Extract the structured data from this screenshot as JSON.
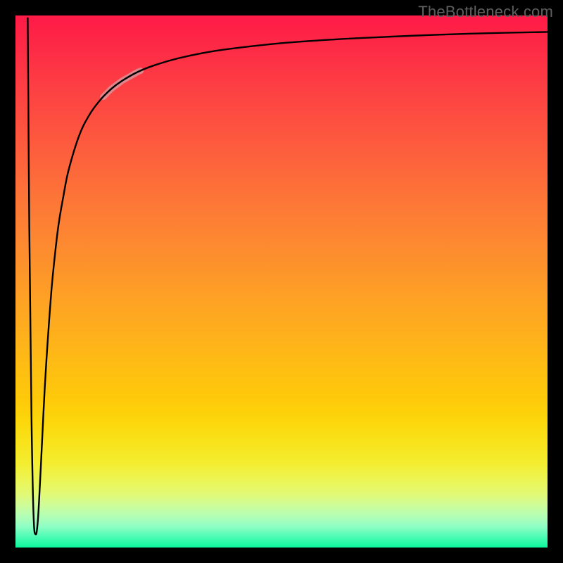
{
  "watermark": "TheBottleneck.com",
  "colors": {
    "page_bg": "#000000",
    "curve_stroke": "#000000",
    "highlight_stroke": "#d79aa0",
    "gradient_top": "#fe1a47",
    "gradient_mid": "#fec90a",
    "gradient_bottom": "#0cf69c",
    "watermark_color": "#5e5e5e"
  },
  "chart_data": {
    "type": "line",
    "title": "",
    "xlabel": "",
    "ylabel": "",
    "xlim": [
      0,
      100
    ],
    "ylim": [
      0,
      100
    ],
    "grid": false,
    "legend": false,
    "series": [
      {
        "name": "bottleneck-curve",
        "x": [
          2.3,
          2.6,
          3.0,
          3.4,
          3.8,
          4.2,
          4.6,
          5.0,
          5.5,
          6.0,
          6.5,
          7.0,
          8.0,
          9.0,
          10,
          12,
          14,
          16,
          18,
          20,
          23,
          26,
          30,
          35,
          40,
          50,
          60,
          70,
          80,
          90,
          100
        ],
        "y": [
          99.5,
          60,
          25,
          6,
          2.5,
          5,
          12,
          20,
          30,
          38,
          45,
          51,
          60,
          66,
          71,
          77.5,
          81.5,
          84.2,
          86.2,
          87.7,
          89.4,
          90.6,
          91.8,
          92.9,
          93.7,
          94.8,
          95.5,
          96.0,
          96.4,
          96.7,
          96.9
        ]
      }
    ],
    "annotations": [
      {
        "name": "highlight-segment",
        "x_range": [
          16.5,
          23.5
        ],
        "note": "thicker pale stroke over part of the curve"
      }
    ]
  }
}
